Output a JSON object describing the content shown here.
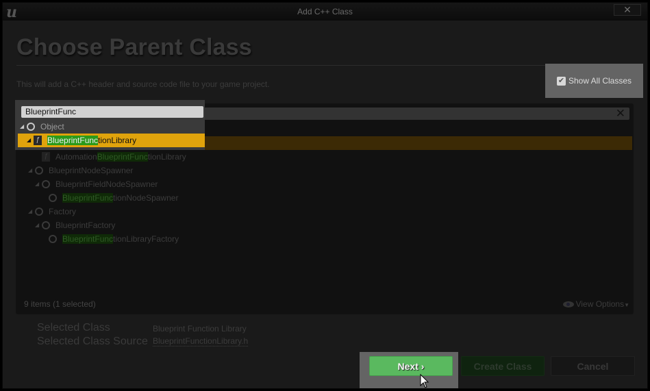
{
  "window": {
    "title": "Add C++ Class",
    "close_glyph": "✕",
    "logo": "u"
  },
  "header": {
    "title": "Choose Parent Class",
    "subtitle": "This will add a C++ header and source code file to your game project."
  },
  "show_all_classes": {
    "label": "Show All Classes",
    "checked": true,
    "check_glyph": "✔"
  },
  "search": {
    "value": "BlueprintFunc",
    "clear_glyph": "✕"
  },
  "tree": [
    {
      "prefix": "",
      "match": "",
      "suffix": "Object",
      "icon": "class-circle-icon",
      "expanded": true,
      "depth": 0
    },
    {
      "prefix": "",
      "match": "BlueprintFunc",
      "suffix": "tionLibrary",
      "icon": "blueprint-function-library-icon",
      "expanded": true,
      "depth": 1,
      "selected": true
    },
    {
      "prefix": "Automation",
      "match": "BlueprintFunc",
      "suffix": "tionLibrary",
      "icon": "blueprint-function-library-icon",
      "expanded": false,
      "depth": 2
    },
    {
      "prefix": "BlueprintNodeSpawner",
      "match": "",
      "suffix": "",
      "icon": "class-circle-icon",
      "expanded": true,
      "depth": 1
    },
    {
      "prefix": "BlueprintFieldNodeSpawner",
      "match": "",
      "suffix": "",
      "icon": "class-circle-icon",
      "expanded": true,
      "depth": 2
    },
    {
      "prefix": "",
      "match": "BlueprintFunc",
      "suffix": "tionNodeSpawner",
      "icon": "class-circle-icon",
      "expanded": false,
      "depth": 3
    },
    {
      "prefix": "Factory",
      "match": "",
      "suffix": "",
      "icon": "class-circle-icon",
      "expanded": true,
      "depth": 1
    },
    {
      "prefix": "BlueprintFactory",
      "match": "",
      "suffix": "",
      "icon": "class-circle-icon",
      "expanded": true,
      "depth": 2
    },
    {
      "prefix": "",
      "match": "BlueprintFunc",
      "suffix": "tionLibraryFactory",
      "icon": "class-circle-icon",
      "expanded": false,
      "depth": 3
    }
  ],
  "status": {
    "items_text": "9 items (1 selected)",
    "view_options": "View Options"
  },
  "selection": {
    "class_label": "Selected Class",
    "class_value": "Blueprint Function Library",
    "source_label": "Selected Class Source",
    "source_value": "BlueprintFunctionLibrary.h"
  },
  "buttons": {
    "next": "Next",
    "next_glyph": "›",
    "create": "Create Class",
    "cancel": "Cancel"
  },
  "colors": {
    "accent_selection": "#e0a30c",
    "match_highlight": "#2a9a1a",
    "next_button": "#5ab95f"
  }
}
